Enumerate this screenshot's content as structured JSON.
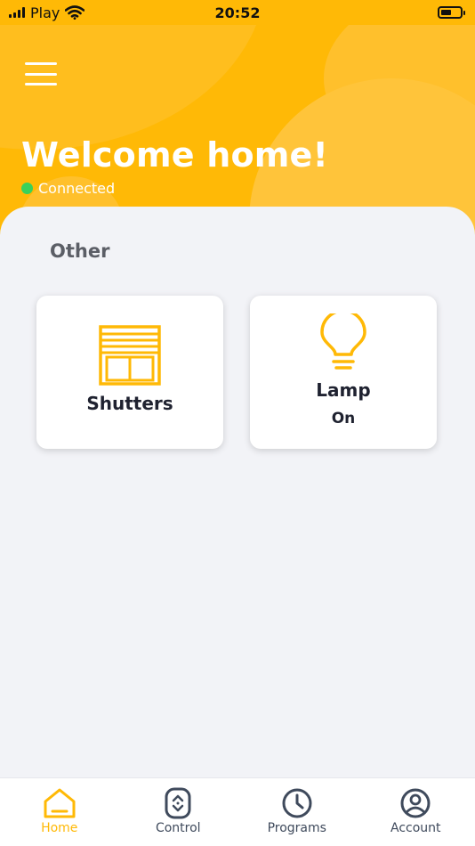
{
  "status_bar": {
    "carrier": "Play",
    "time": "20:52"
  },
  "header": {
    "title": "Welcome home!",
    "connection_status": "Connected",
    "connection_color": "#3ad15a"
  },
  "section": {
    "title": "Other"
  },
  "devices": [
    {
      "label": "Shutters",
      "icon": "shutters-icon"
    },
    {
      "label": "Lamp",
      "status": "On",
      "icon": "lightbulb-icon"
    }
  ],
  "tabbar": {
    "items": [
      {
        "label": "Home",
        "icon": "home-icon",
        "active": true
      },
      {
        "label": "Control",
        "icon": "remote-control-icon",
        "active": false
      },
      {
        "label": "Programs",
        "icon": "clock-icon",
        "active": false
      },
      {
        "label": "Account",
        "icon": "account-icon",
        "active": false
      }
    ]
  },
  "colors": {
    "brand": "#ffb906",
    "background": "#f2f3f7",
    "text_dark": "#1f2230",
    "tab_inactive": "#3f4a5c"
  }
}
